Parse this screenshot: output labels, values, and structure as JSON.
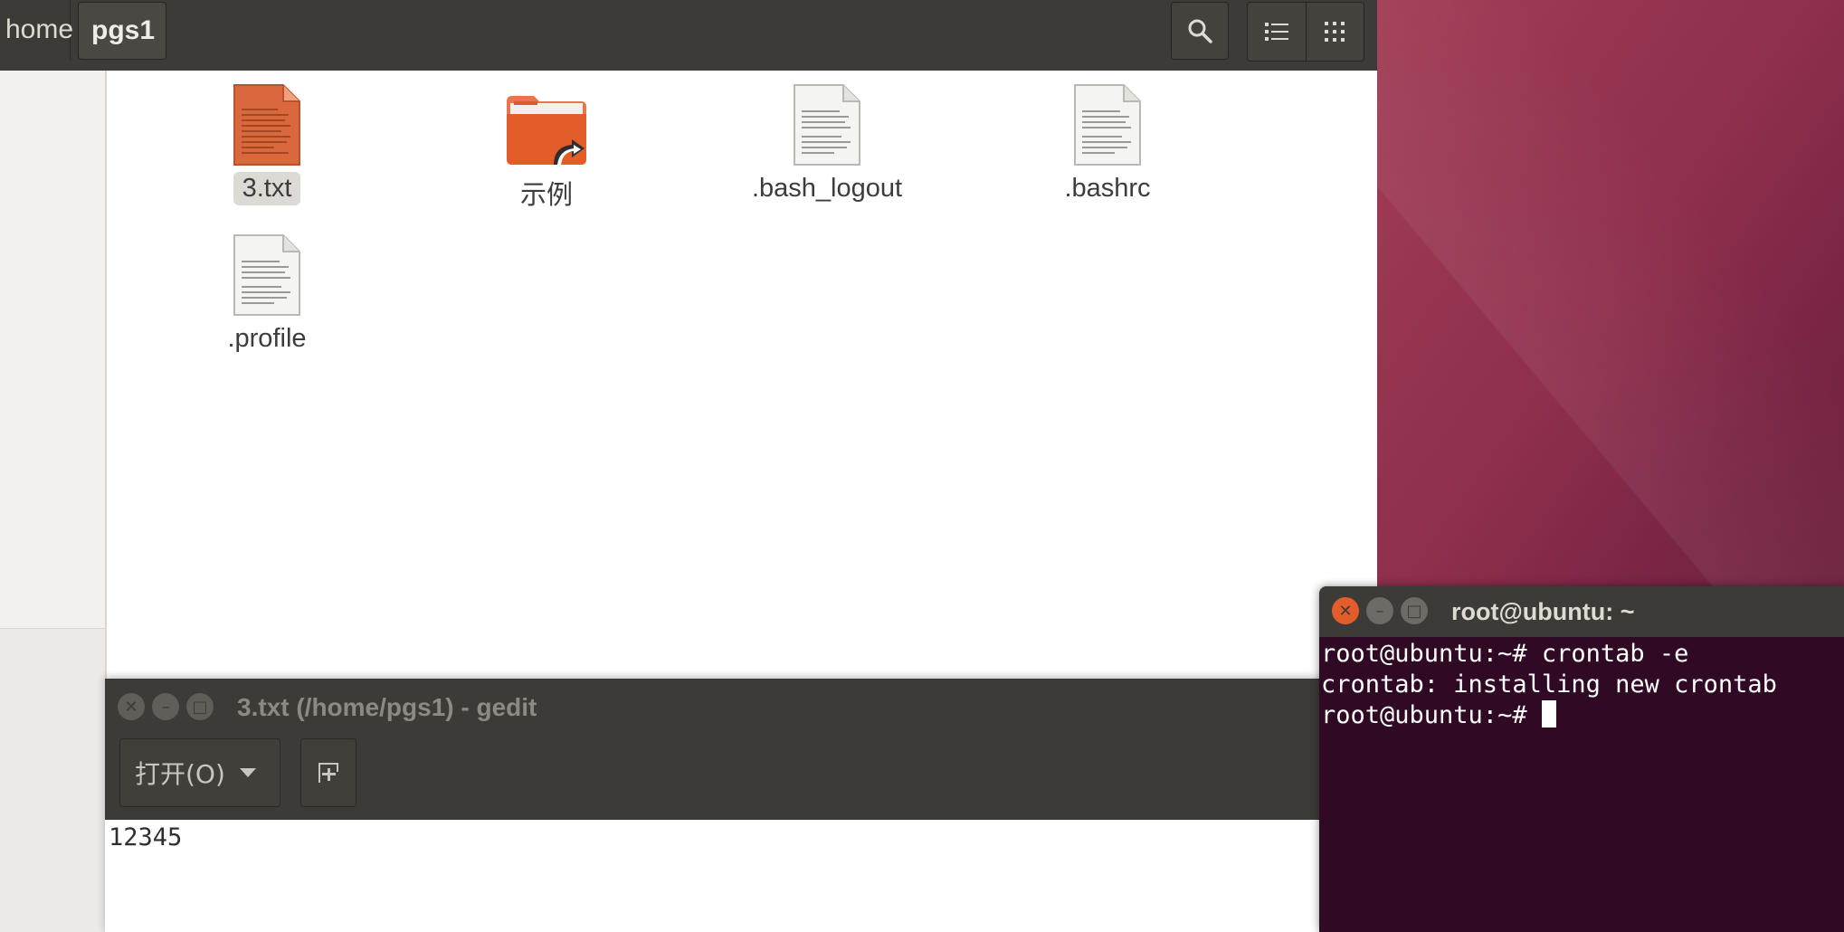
{
  "file_manager": {
    "breadcrumbs": [
      "home",
      "pgs1"
    ],
    "files": [
      {
        "name": "3.txt",
        "icon": "text-file-orange-icon",
        "selected": true
      },
      {
        "name": "示例",
        "icon": "folder-link-icon",
        "selected": false
      },
      {
        "name": ".bash_logout",
        "icon": "text-file-icon",
        "selected": false
      },
      {
        "name": ".bashrc",
        "icon": "text-file-icon",
        "selected": false
      },
      {
        "name": ".profile",
        "icon": "text-file-icon",
        "selected": false
      }
    ],
    "toolbar_icons": [
      "search-icon",
      "list-view-icon",
      "grid-view-icon"
    ]
  },
  "gedit": {
    "title": "3.txt (/home/pgs1) - gedit",
    "open_label": "打开(O)",
    "content": "12345",
    "new_tab_icon": "new-document-icon"
  },
  "terminal": {
    "title": "root@ubuntu: ~",
    "lines": [
      "root@ubuntu:~# crontab -e",
      "crontab: installing new crontab",
      "root@ubuntu:~# "
    ]
  },
  "colors": {
    "ubuntu_orange": "#e35d2a",
    "header_dark": "#3c3b37",
    "terminal_bg": "#300a24"
  }
}
